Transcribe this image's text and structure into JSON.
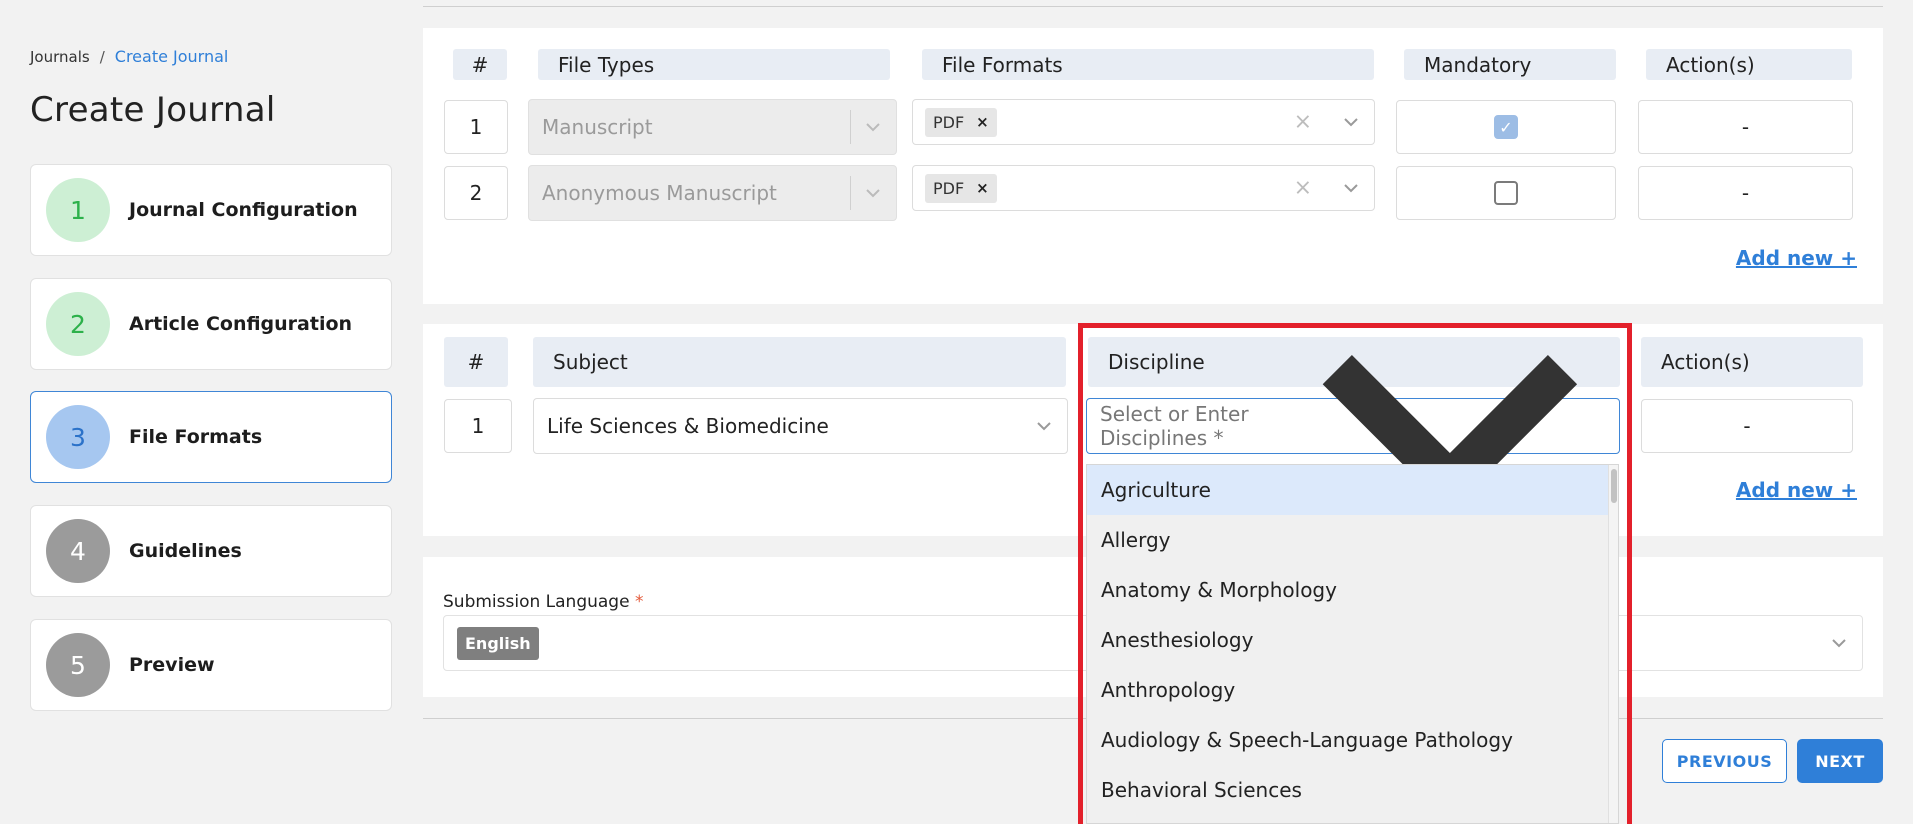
{
  "breadcrumb": {
    "root": "Journals",
    "separator": "/",
    "current": "Create Journal"
  },
  "page_title": "Create Journal",
  "steps": [
    {
      "number": "1",
      "label": "Journal Configuration",
      "state": "done"
    },
    {
      "number": "2",
      "label": "Article Configuration",
      "state": "done"
    },
    {
      "number": "3",
      "label": "File Formats",
      "state": "current"
    },
    {
      "number": "4",
      "label": "Guidelines",
      "state": "todo"
    },
    {
      "number": "5",
      "label": "Preview",
      "state": "todo"
    }
  ],
  "file_types_table": {
    "headers": {
      "num": "#",
      "file_types": "File Types",
      "file_formats": "File Formats",
      "mandatory": "Mandatory",
      "actions": "Action(s)"
    },
    "rows": [
      {
        "num": "1",
        "file_type": "Manuscript",
        "format_tag": "PDF",
        "mandatory": true,
        "action": "-"
      },
      {
        "num": "2",
        "file_type": "Anonymous Manuscript",
        "format_tag": "PDF",
        "mandatory": false,
        "action": "-"
      }
    ],
    "add_new": "Add new +"
  },
  "subjects_table": {
    "headers": {
      "num": "#",
      "subject": "Subject",
      "discipline": "Discipline",
      "actions": "Action(s)"
    },
    "rows": [
      {
        "num": "1",
        "subject": "Life Sciences & Biomedicine",
        "discipline_placeholder": "Select or Enter Disciplines *",
        "action": "-"
      }
    ],
    "add_new": "Add new +"
  },
  "discipline_options": [
    "Agriculture",
    "Allergy",
    "Anatomy & Morphology",
    "Anesthesiology",
    "Anthropology",
    "Audiology & Speech-Language Pathology",
    "Behavioral Sciences"
  ],
  "submission_language": {
    "label": "Submission Language",
    "required_mark": "*",
    "tag": "English"
  },
  "buttons": {
    "previous": "PREVIOUS",
    "next": "NEXT"
  },
  "colors": {
    "accent": "#2f7fd8",
    "highlight": "#e3202b",
    "done": "#2db14b"
  }
}
